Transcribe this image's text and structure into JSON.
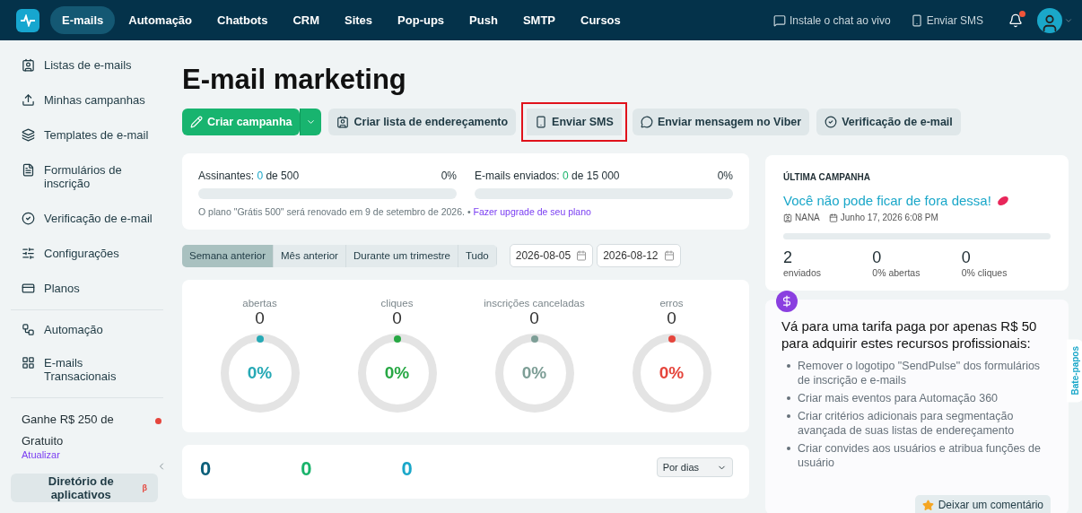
{
  "topnav": {
    "items": [
      {
        "label": "E-mails",
        "selected": true
      },
      {
        "label": "Automação",
        "selected": false
      },
      {
        "label": "Chatbots",
        "selected": false
      },
      {
        "label": "CRM",
        "selected": false
      },
      {
        "label": "Sites",
        "selected": false
      },
      {
        "label": "Pop-ups",
        "selected": false
      },
      {
        "label": "Push",
        "selected": false
      },
      {
        "label": "SMTP",
        "selected": false
      },
      {
        "label": "Cursos",
        "selected": false
      }
    ],
    "live_chat": "Instale o chat ao vivo",
    "send_sms": "Enviar SMS",
    "notifications_unread": true
  },
  "sidebar": {
    "items": [
      {
        "label": "Listas de e-mails"
      },
      {
        "label": "Minhas campanhas"
      },
      {
        "label": "Templates de e-mail"
      },
      {
        "label": "Formulários de inscrição"
      },
      {
        "label": "Verificação de e-mail"
      },
      {
        "label": "Configurações"
      },
      {
        "label": "Planos"
      }
    ],
    "items_2": [
      {
        "label": "Automação"
      },
      {
        "label": "E-mails Transacionais"
      }
    ],
    "promo": {
      "title": "Ganhe R$ 250 de",
      "plan": "Gratuito",
      "link": "Atualizar"
    },
    "app_directory": {
      "label": "Diretório de aplicativos",
      "badge": "β"
    }
  },
  "page": {
    "title": "E-mail marketing",
    "actions": [
      {
        "label": "Criar campanha",
        "kind": "primary",
        "highlighted": false
      },
      {
        "label": "Criar lista de endereçamento",
        "kind": "secondary",
        "highlighted": false
      },
      {
        "label": "Enviar SMS",
        "kind": "secondary",
        "highlighted": true
      },
      {
        "label": "Enviar mensagem no Viber",
        "kind": "secondary",
        "highlighted": false
      },
      {
        "label": "Verificação de e-mail",
        "kind": "secondary",
        "highlighted": false
      }
    ],
    "usage": [
      {
        "label": "Assinantes:",
        "count": "0",
        "of": "de 500",
        "percent": "0%",
        "level": 0,
        "color": "#1aa7c9"
      },
      {
        "label": "E-mails enviados:",
        "count": "0",
        "of": "de 15 000",
        "percent": "0%",
        "level": 0,
        "color": "#19b36b"
      }
    ],
    "plan_note": "O plano \"Grátis 500\" será renovado em 9 de setembro de 2026. •",
    "plan_link": "Fazer upgrade de seu plano",
    "periods": [
      {
        "label": "Semana anterior",
        "selected": true
      },
      {
        "label": "Mês anterior",
        "selected": false
      },
      {
        "label": "Durante um trimestre",
        "selected": false
      },
      {
        "label": "Tudo",
        "selected": false
      }
    ],
    "date_from": "2026-08-05",
    "date_to": "2026-08-12",
    "stats": [
      {
        "label": "abertas",
        "value": "0",
        "percent": "0%",
        "color": "#26a9b5"
      },
      {
        "label": "cliques",
        "value": "0",
        "percent": "0%",
        "color": "#27a844"
      },
      {
        "label": "inscrições canceladas",
        "value": "0",
        "percent": "0%",
        "color": "#7d9e96"
      },
      {
        "label": "erros",
        "value": "0",
        "percent": "0%",
        "color": "#e5453c"
      }
    ],
    "totals": [
      {
        "value": "0",
        "color": "#0b5f7a"
      },
      {
        "value": "0",
        "color": "#19b36b"
      },
      {
        "value": "0",
        "color": "#1aa7c9"
      }
    ],
    "group_by": "Por dias"
  },
  "last_campaign": {
    "heading": "ÚLTIMA CAMPANHA",
    "name": "Você não pode ficar de fora dessa!",
    "sender": "NANA",
    "date": "Junho 17, 2026 6:08 PM",
    "level": 0,
    "metrics": [
      {
        "value": "2",
        "label": "enviados"
      },
      {
        "value": "0",
        "label": "0% abertas"
      },
      {
        "value": "0",
        "label": "0% cliques"
      }
    ]
  },
  "upgrade": {
    "title": "Vá para uma tarifa paga por apenas R$ 50 para adquirir estes recursos profissionais:",
    "features": [
      "Remover o logotipo \"SendPulse\" dos formulários de inscrição e e-mails",
      "Criar mais eventos para Automação 360",
      "Criar critérios adicionais para segmentação avançada de suas listas de endereçamento",
      "Criar convides aos usuários e atribua funções de usuário"
    ]
  },
  "feedback": "Deixar um comentário",
  "chat_tab": "Bate-papos"
}
